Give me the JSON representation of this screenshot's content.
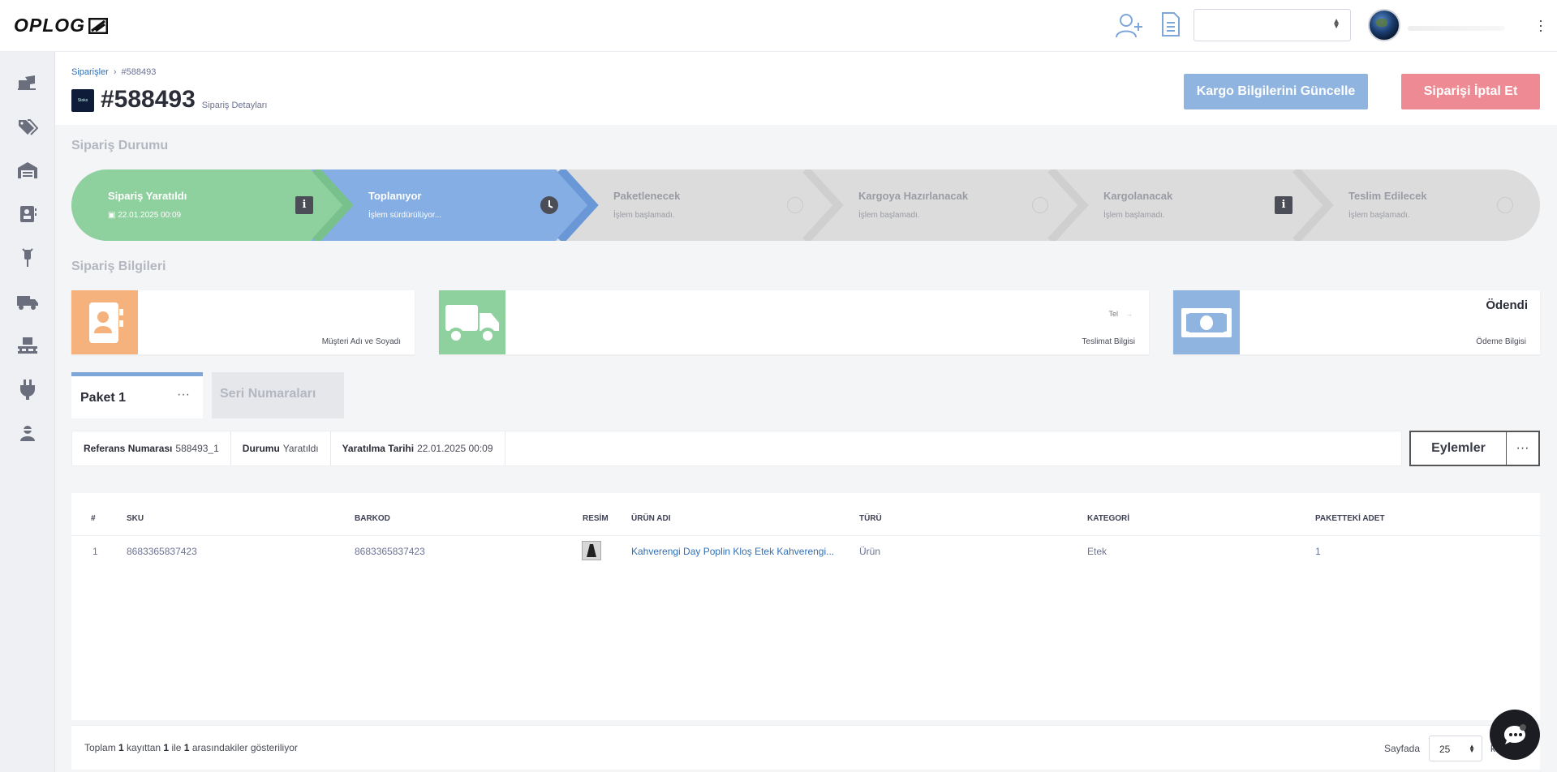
{
  "topbar": {
    "logo_text": "OPLOG",
    "icons": [
      "add-user-icon",
      "document-icon"
    ],
    "select_value": "",
    "user_name": ""
  },
  "sidebar": {
    "items": [
      "orders-icon",
      "tags-icon",
      "warehouse-icon",
      "contacts-icon",
      "product-icon",
      "truck-icon",
      "pallet-icon",
      "plug-icon",
      "user-icon"
    ]
  },
  "breadcrumb": {
    "root": "Siparişler",
    "sep": "›",
    "current": "#588493"
  },
  "header": {
    "badge_text": "Stoks",
    "order_number": "#588493",
    "subtitle": "Sipariş Detayları",
    "update_cargo_label": "Kargo Bilgilerini Güncelle",
    "cancel_order_label": "Siparişi İptal Et"
  },
  "status": {
    "section_title": "Sipariş Durumu",
    "steps": [
      {
        "title": "Sipariş Yaratıldı",
        "sub": "22.01.2025 00:09",
        "state": "done",
        "color": "#8fd19e"
      },
      {
        "title": "Toplanıyor",
        "sub": "İşlem sürdürülüyor...",
        "state": "active",
        "color": "#84aee4"
      },
      {
        "title": "Paketlenecek",
        "sub": "İşlem başlamadı.",
        "state": "pending",
        "color": "#dcdcdc"
      },
      {
        "title": "Kargoya Hazırlanacak",
        "sub": "İşlem başlamadı.",
        "state": "pending",
        "color": "#dcdcdc"
      },
      {
        "title": "Kargolanacak",
        "sub": "İşlem başlamadı.",
        "state": "pending",
        "color": "#dcdcdc"
      },
      {
        "title": "Teslim Edilecek",
        "sub": "İşlem başlamadı.",
        "state": "pending",
        "color": "#dcdcdc"
      }
    ]
  },
  "info": {
    "section_title": "Sipariş Bilgileri",
    "customer": {
      "label": "Müşteri Adı ve Soyadı",
      "color": "#f5b27c"
    },
    "shipping": {
      "label": "Teslimat Bilgisi",
      "phone_label": "Tel",
      "color": "#8fd19e"
    },
    "payment": {
      "label": "Ödeme Bilgisi",
      "status": "Ödendi",
      "color": "#8fb4e0"
    }
  },
  "tabs": {
    "package": "Paket 1",
    "package_menu": "···",
    "serials": "Seri Numaraları"
  },
  "package": {
    "ref_label": "Referans Numarası",
    "ref_value": "588493_1",
    "status_label": "Durumu",
    "status_value": "Yaratıldı",
    "date_label": "Yaratılma Tarihi",
    "date_value": "22.01.2025 00:09",
    "actions_label": "Eylemler",
    "more_label": "···"
  },
  "table": {
    "headers": [
      "#",
      "SKU",
      "BARKOD",
      "RESİM",
      "ÜRÜN ADI",
      "TÜRÜ",
      "KATEGORİ",
      "PAKETTEKİ ADET"
    ],
    "rows": [
      {
        "index": "1",
        "sku": "8683365837423",
        "barcode": "8683365837423",
        "name": "Kahverengi Day Poplin Kloş Etek Kahverengi...",
        "type": "Ürün",
        "category": "Etek",
        "qty": "1"
      }
    ]
  },
  "footer": {
    "t1": "Toplam ",
    "total": "1",
    "t2": " kayıttan ",
    "from": "1",
    "t3": " ile ",
    "to": "1",
    "t4": " arasındakiler gösteriliyor",
    "page_label": "Sayfada",
    "page_size": "25",
    "page_after": "kayıt"
  }
}
